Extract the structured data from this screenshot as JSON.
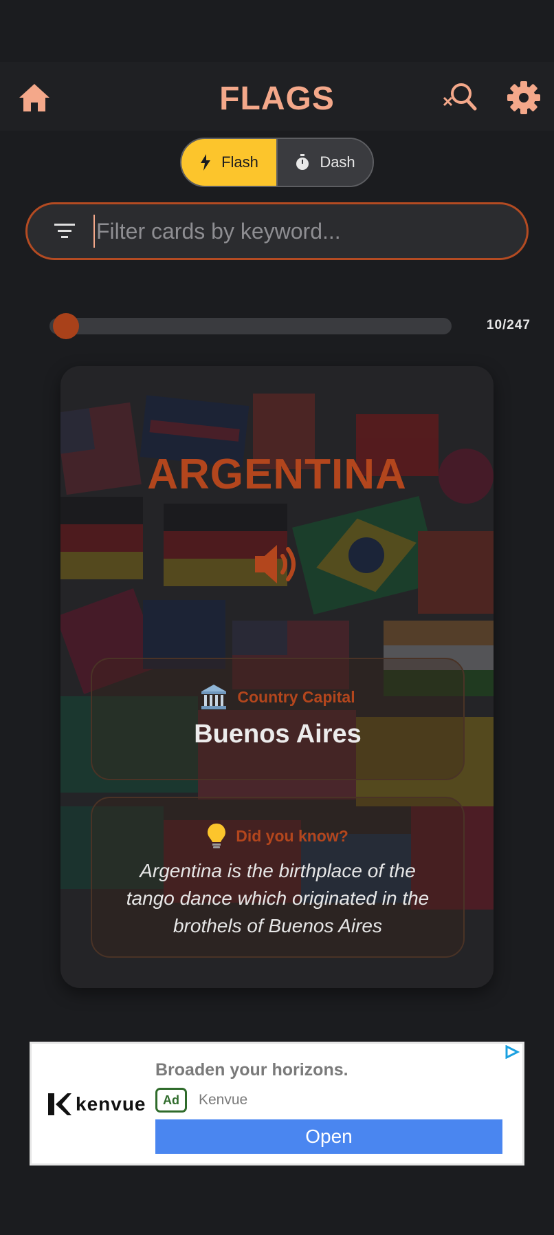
{
  "header": {
    "title": "FLAGS",
    "accent_color": "#f4a88a",
    "icons": [
      "home-icon",
      "search-x-icon",
      "gear-icon"
    ]
  },
  "mode_toggle": {
    "options": [
      {
        "label": "Flash",
        "icon": "lightning-icon",
        "selected": true
      },
      {
        "label": "Dash",
        "icon": "stopwatch-icon",
        "selected": false
      }
    ],
    "selected_color": "#fcc52c"
  },
  "search": {
    "placeholder": "Filter cards by keyword...",
    "value": "",
    "border_color": "#b44b22"
  },
  "progress": {
    "label": "10/247",
    "current": 10,
    "total": 247
  },
  "card": {
    "country": "ARGENTINA",
    "country_color": "#b3461d",
    "speaker_icon": "speaker-icon",
    "capital": {
      "icon": "building-icon",
      "label": "Country Capital",
      "value": "Buenos Aires"
    },
    "fact": {
      "icon": "lightbulb-icon",
      "label": "Did you know?",
      "text": "Argentina is the birthplace of the tango dance which originated in the brothels of Buenos Aires"
    }
  },
  "ad": {
    "brand": "kenvue",
    "title": "Broaden your horizons.",
    "badge": "Ad",
    "advertiser": "Kenvue",
    "cta": "Open",
    "cta_color": "#4a86f0"
  }
}
